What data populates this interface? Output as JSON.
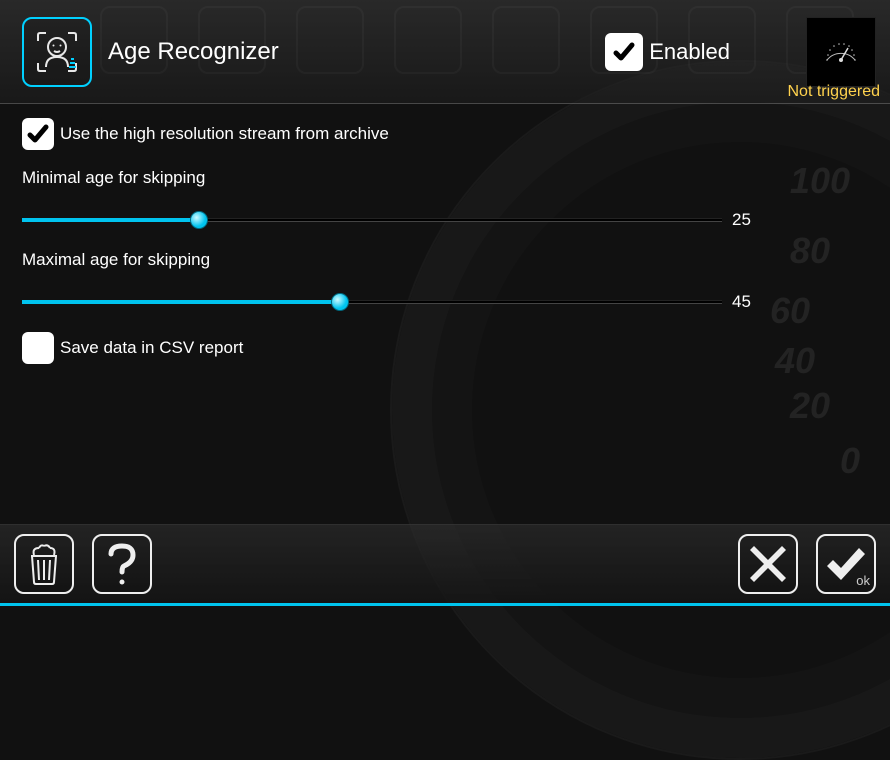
{
  "header": {
    "title": "Age Recognizer",
    "enabled_label": "Enabled",
    "enabled_checked": true
  },
  "status": {
    "text": "Not triggered"
  },
  "options": {
    "hires_label": "Use the high resolution stream from archive",
    "hires_checked": true,
    "csv_label": "Save data in CSV report",
    "csv_checked": false
  },
  "sliders": {
    "min": {
      "label": "Minimal age for skipping",
      "value": 25,
      "max": 99
    },
    "max": {
      "label": "Maximal age for skipping",
      "value": 45,
      "max": 99
    }
  },
  "footer": {
    "ok_sub": "ok"
  },
  "icons": {
    "module": "face-scan-icon",
    "trash": "trash-icon",
    "help": "help-icon",
    "cancel": "close-icon",
    "ok": "check-icon"
  },
  "colors": {
    "accent": "#00c4ef",
    "warning": "#ffd24d",
    "text": "#ffffff"
  }
}
